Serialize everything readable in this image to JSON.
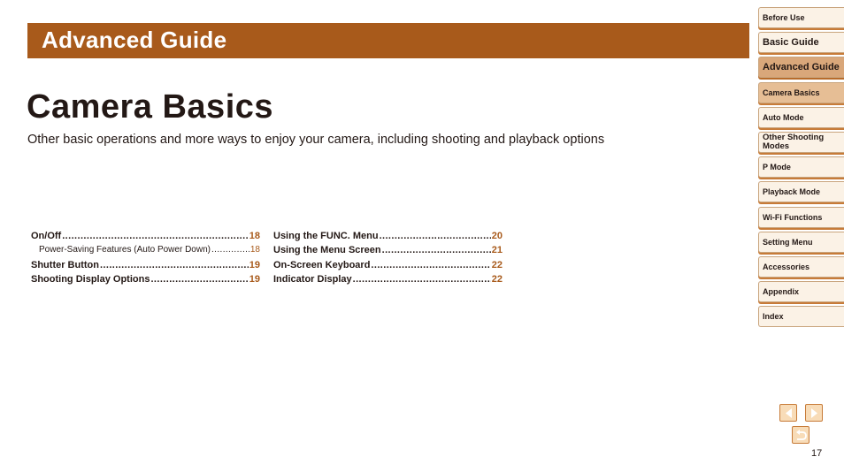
{
  "header": {
    "banner_title": "Advanced Guide",
    "page_title": "Camera Basics",
    "subtitle": "Other basic operations and more ways to enjoy your camera, including shooting and playback options"
  },
  "toc": {
    "column1": [
      {
        "label": "On/Off",
        "page": "18",
        "level": 1
      },
      {
        "label": "Power-Saving Features (Auto Power Down)",
        "page": "18",
        "level": 2
      },
      {
        "label": "Shutter Button",
        "page": "19",
        "level": 1
      },
      {
        "label": "Shooting Display Options",
        "page": "19",
        "level": 1
      }
    ],
    "column2": [
      {
        "label": "Using the FUNC. Menu",
        "page": "20",
        "level": 1
      },
      {
        "label": "Using the Menu Screen",
        "page": "21",
        "level": 1
      },
      {
        "label": "On-Screen Keyboard",
        "page": "22",
        "level": 1
      },
      {
        "label": "Indicator Display",
        "page": "22",
        "level": 1
      }
    ]
  },
  "sidebar": {
    "items": [
      {
        "label": "Before Use"
      },
      {
        "label": "Basic Guide"
      },
      {
        "label": "Advanced Guide",
        "active": true
      },
      {
        "label": "Camera Basics",
        "current": true
      },
      {
        "label": "Auto Mode"
      },
      {
        "label": "Other Shooting Modes"
      },
      {
        "label": "P Mode"
      },
      {
        "label": "Playback Mode"
      },
      {
        "label": "Wi-Fi Functions"
      },
      {
        "label": "Setting Menu"
      },
      {
        "label": "Accessories"
      },
      {
        "label": "Appendix"
      },
      {
        "label": "Index"
      }
    ]
  },
  "navigation": {
    "prev_icon": "triangle-left-icon",
    "next_icon": "triangle-right-icon",
    "return_icon": "return-arrow-icon",
    "page_number": "17"
  },
  "colors": {
    "accent": "#a85a1b",
    "text": "#231815",
    "tab_bg": "#fbf2e6",
    "tab_active": "#d9a77a"
  }
}
